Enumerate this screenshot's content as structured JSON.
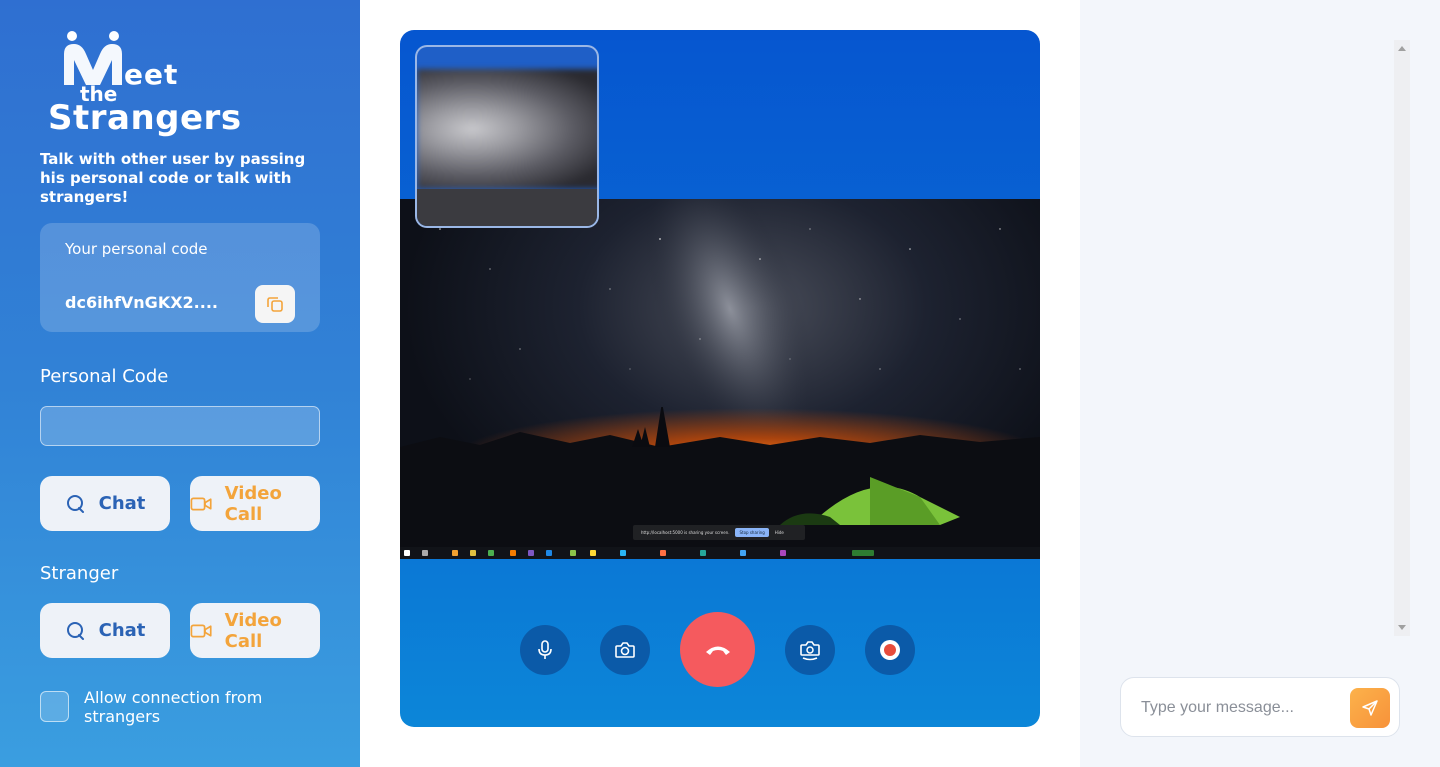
{
  "brand": {
    "logo_word1": "eet",
    "logo_word2": "the",
    "logo_word3": "Strangers",
    "tagline": "Talk with other user by passing his personal code or talk with strangers!"
  },
  "personal_code_card": {
    "label": "Your personal code",
    "code": "dc6ihfVnGKX2...."
  },
  "personal_code_section": {
    "title": "Personal Code",
    "input_value": "",
    "chat_label": "Chat",
    "video_label": "Video Call"
  },
  "stranger_section": {
    "title": "Stranger",
    "chat_label": "Chat",
    "video_label": "Video Call"
  },
  "allow_strangers": {
    "label": "Allow connection from strangers",
    "checked": false
  },
  "screen_share": {
    "message": "http://localhost:5000 is sharing your screen.",
    "stop_label": "Stop sharing",
    "hide_label": "Hide"
  },
  "call_controls": {
    "icons": [
      "microphone-icon",
      "camera-icon",
      "hang-up-icon",
      "switch-camera-icon",
      "record-icon"
    ]
  },
  "chat": {
    "placeholder": "Type your message...",
    "send_icon": "send-icon"
  },
  "colors": {
    "sidebar_top": "#2f6fd1",
    "sidebar_bottom": "#3a9ee0",
    "accent_orange": "#f3a43b",
    "hangup_red": "#f55a5e",
    "chat_bg": "#f3f6fb"
  }
}
